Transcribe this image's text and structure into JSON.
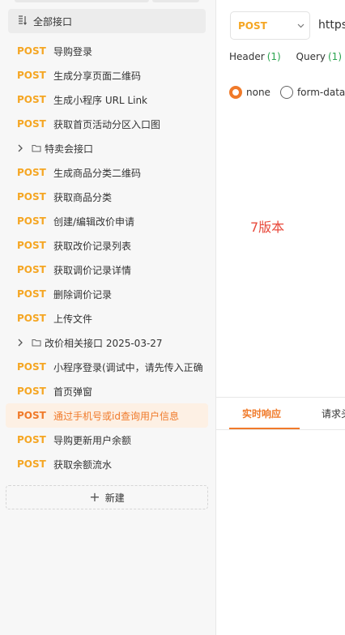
{
  "sidebar": {
    "all_api_label": "全部接口",
    "items": [
      {
        "type": "api",
        "method": "POST",
        "name": "导购登录"
      },
      {
        "type": "api",
        "method": "POST",
        "name": "生成分享页面二维码"
      },
      {
        "type": "api",
        "method": "POST",
        "name": "生成小程序 URL Link"
      },
      {
        "type": "api",
        "method": "POST",
        "name": "获取首页活动分区入口图"
      },
      {
        "type": "folder",
        "name": "特卖会接口"
      },
      {
        "type": "api",
        "method": "POST",
        "name": "生成商品分类二维码"
      },
      {
        "type": "api",
        "method": "POST",
        "name": "获取商品分类"
      },
      {
        "type": "api",
        "method": "POST",
        "name": "创建/编辑改价申请"
      },
      {
        "type": "api",
        "method": "POST",
        "name": "获取改价记录列表"
      },
      {
        "type": "api",
        "method": "POST",
        "name": "获取调价记录详情"
      },
      {
        "type": "api",
        "method": "POST",
        "name": "删除调价记录"
      },
      {
        "type": "api",
        "method": "POST",
        "name": "上传文件"
      },
      {
        "type": "folder",
        "name": "改价相关接口 2025-03-27"
      },
      {
        "type": "api",
        "method": "POST",
        "name": "小程序登录(调试中，请先传入正确"
      },
      {
        "type": "api",
        "method": "POST",
        "name": "首页弹窗"
      },
      {
        "type": "api",
        "method": "POST",
        "name": "通过手机号或id查询用户信息",
        "active": true
      },
      {
        "type": "api",
        "method": "POST",
        "name": "导购更新用户余额"
      },
      {
        "type": "api",
        "method": "POST",
        "name": "获取余额流水"
      }
    ],
    "new_button_label": "新建"
  },
  "request": {
    "method": "POST",
    "url_partial": "https:",
    "tabs": [
      {
        "label": "Header",
        "count": "(1)"
      },
      {
        "label": "Query",
        "count": "(1)"
      }
    ],
    "body_options": [
      {
        "label": "none",
        "checked": true
      },
      {
        "label": "form-data",
        "checked": false
      }
    ],
    "note": "7版本"
  },
  "response": {
    "tabs": [
      {
        "label": "实时响应",
        "active": true
      },
      {
        "label": "请求头"
      }
    ]
  },
  "colors": {
    "method_post": "#f5a623",
    "accent": "#f07a2a",
    "count_green": "#2aa44f",
    "note_red": "#e84a3c"
  }
}
